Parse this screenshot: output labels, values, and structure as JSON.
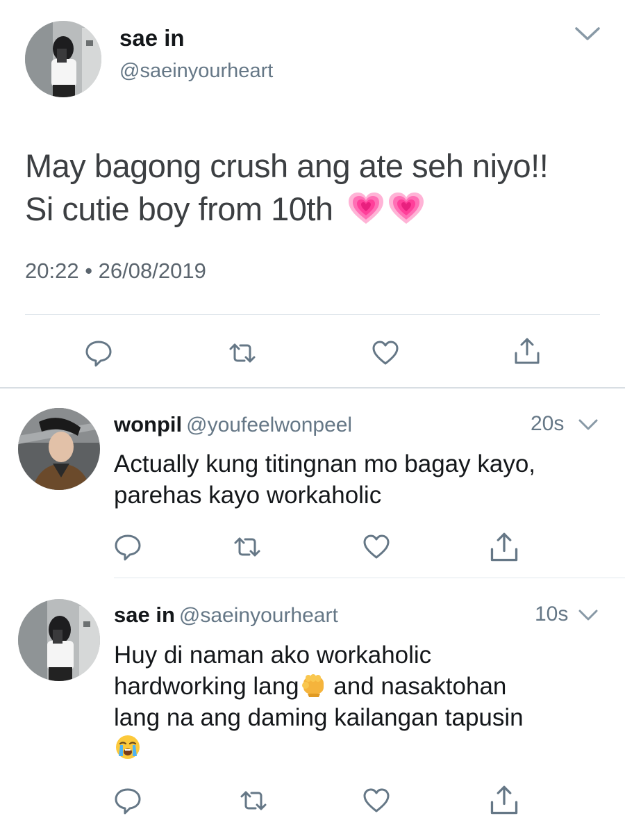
{
  "main_tweet": {
    "author_name": "sae in",
    "author_handle": "@saeinyourheart",
    "text_line_1": "May bagong crush ang ate seh niyo!!",
    "text_line_2": "Si cutie boy from 10th",
    "emojis": [
      "growing-heart-emoji",
      "growing-heart-emoji"
    ],
    "timestamp": "20:22 • 26/08/2019",
    "actions": [
      "reply-icon",
      "retweet-icon",
      "like-icon",
      "share-icon"
    ]
  },
  "replies": [
    {
      "author_name": "wonpil",
      "author_handle": "@youfeelwonpeel",
      "time": "20s",
      "text_lines": [
        "Actually kung titingnan mo bagay kayo,",
        "parehas kayo workaholic"
      ]
    },
    {
      "author_name": "sae in",
      "author_handle": "@saeinyourheart",
      "time": "10s",
      "text_lines": [
        "Huy di naman ako workaholic",
        "hardworking lang",
        " and nasaktohan",
        "lang na ang daming kailangan tapusin"
      ],
      "emojis": [
        "oncoming-fist-emoji",
        "loudly-crying-face-emoji"
      ]
    }
  ],
  "colors": {
    "text_primary": "#14171a",
    "text_secondary": "#657786",
    "divider": "#e1e8ed",
    "icon": "#657786",
    "heart_emoji": "#ff5fa8"
  }
}
